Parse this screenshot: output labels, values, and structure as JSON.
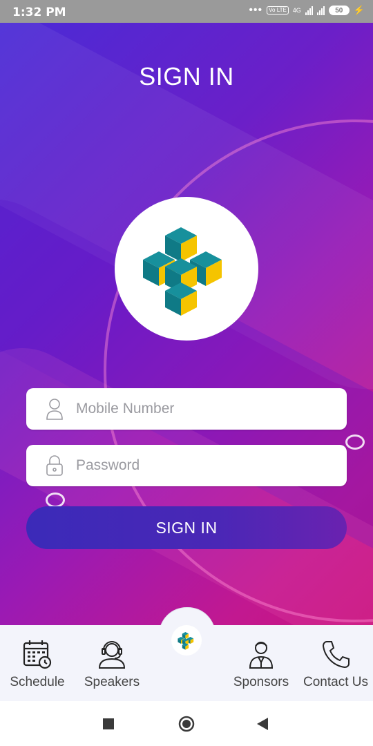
{
  "status_bar": {
    "time": "1:32 PM",
    "network": "4G",
    "volte": "Vo LTE",
    "battery": "50"
  },
  "header": {
    "title": "SIGN IN"
  },
  "logo": {
    "icon": "cube-logo-icon"
  },
  "form": {
    "mobile_placeholder": "Mobile Number",
    "password_placeholder": "Password",
    "submit_label": "SIGN IN"
  },
  "bottom_nav": {
    "items": [
      {
        "label": "Schedule",
        "icon": "calendar-clock-icon"
      },
      {
        "label": "Speakers",
        "icon": "headset-person-icon"
      },
      {
        "label": "",
        "icon": "cube-logo-icon"
      },
      {
        "label": "Sponsors",
        "icon": "person-suit-icon"
      },
      {
        "label": "Contact Us",
        "icon": "phone-icon"
      }
    ]
  },
  "colors": {
    "accent": "#3b2ab8",
    "gradient_start": "#4a2bd6",
    "gradient_end": "#c8147e",
    "logo_teal": "#0f7a86",
    "logo_yellow": "#f5c400"
  }
}
